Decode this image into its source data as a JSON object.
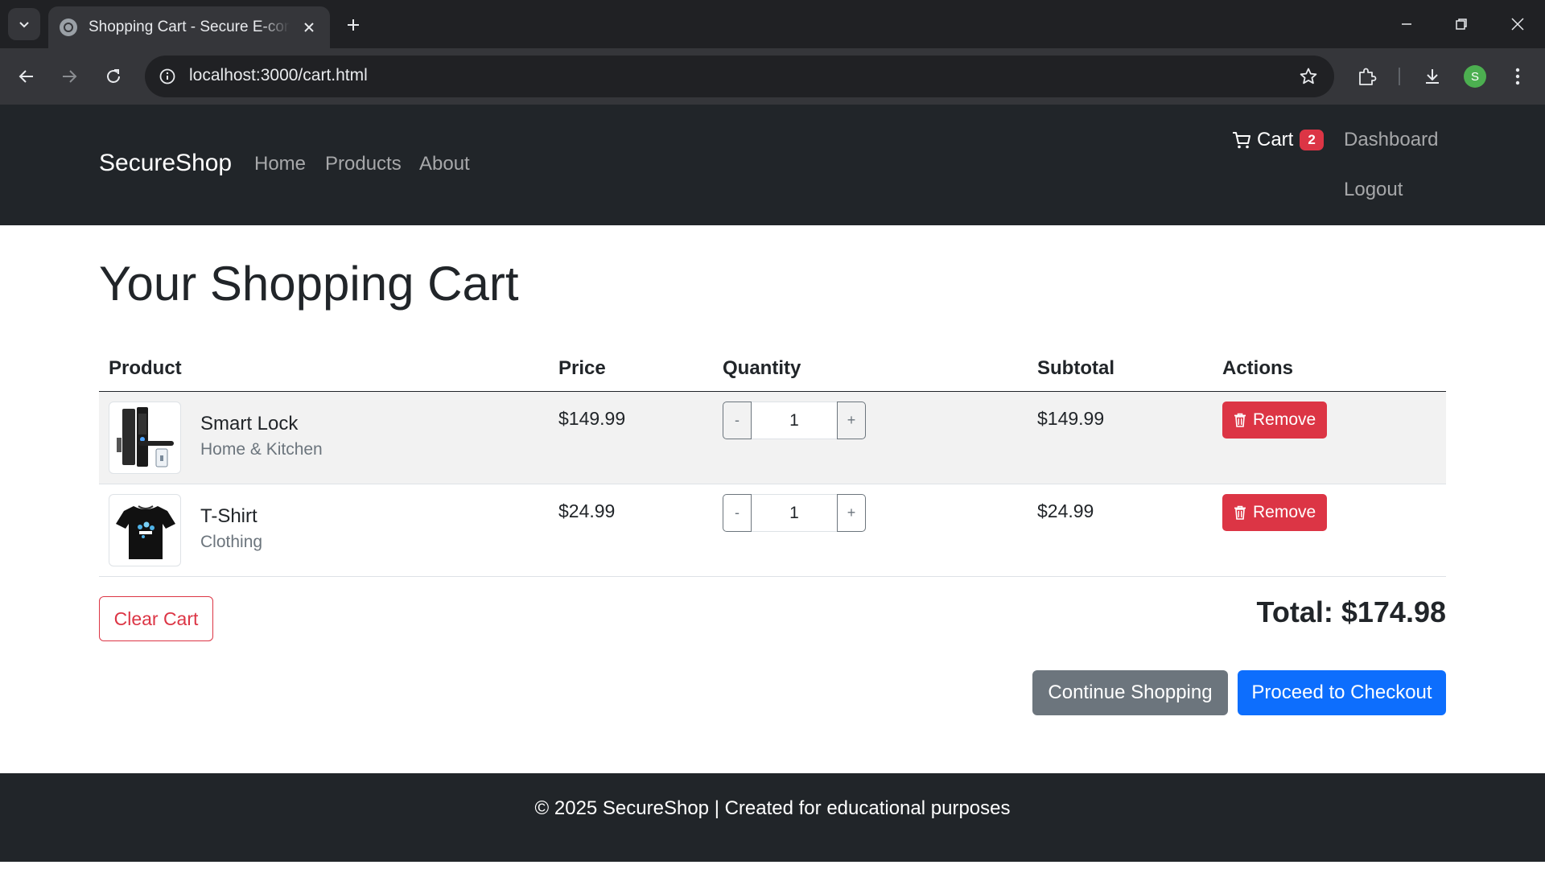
{
  "browser": {
    "tab_title": "Shopping Cart - Secure E-commerce",
    "url": "localhost:3000/cart.html",
    "profile_initial": "S"
  },
  "navbar": {
    "brand": "SecureShop",
    "links": [
      "Home",
      "Products",
      "About"
    ],
    "cart_label": "Cart",
    "cart_count": "2",
    "dashboard": "Dashboard",
    "logout": "Logout"
  },
  "main": {
    "title": "Your Shopping Cart",
    "columns": [
      "Product",
      "Price",
      "Quantity",
      "Subtotal",
      "Actions"
    ],
    "items": [
      {
        "name": "Smart Lock",
        "category": "Home & Kitchen",
        "price": "$149.99",
        "quantity": "1",
        "subtotal": "$149.99",
        "remove_label": "Remove",
        "minus": "-",
        "plus": "+"
      },
      {
        "name": "T-Shirt",
        "category": "Clothing",
        "price": "$24.99",
        "quantity": "1",
        "subtotal": "$24.99",
        "remove_label": "Remove",
        "minus": "-",
        "plus": "+"
      }
    ],
    "clear_cart": "Clear Cart",
    "total": "Total: $174.98",
    "continue_shopping": "Continue Shopping",
    "checkout": "Proceed to Checkout"
  },
  "footer": {
    "text": "© 2025 SecureShop | Created for educational purposes"
  },
  "colors": {
    "danger": "#dc3545",
    "primary": "#0d6efd",
    "secondary": "#6c757d",
    "dark": "#212529"
  }
}
